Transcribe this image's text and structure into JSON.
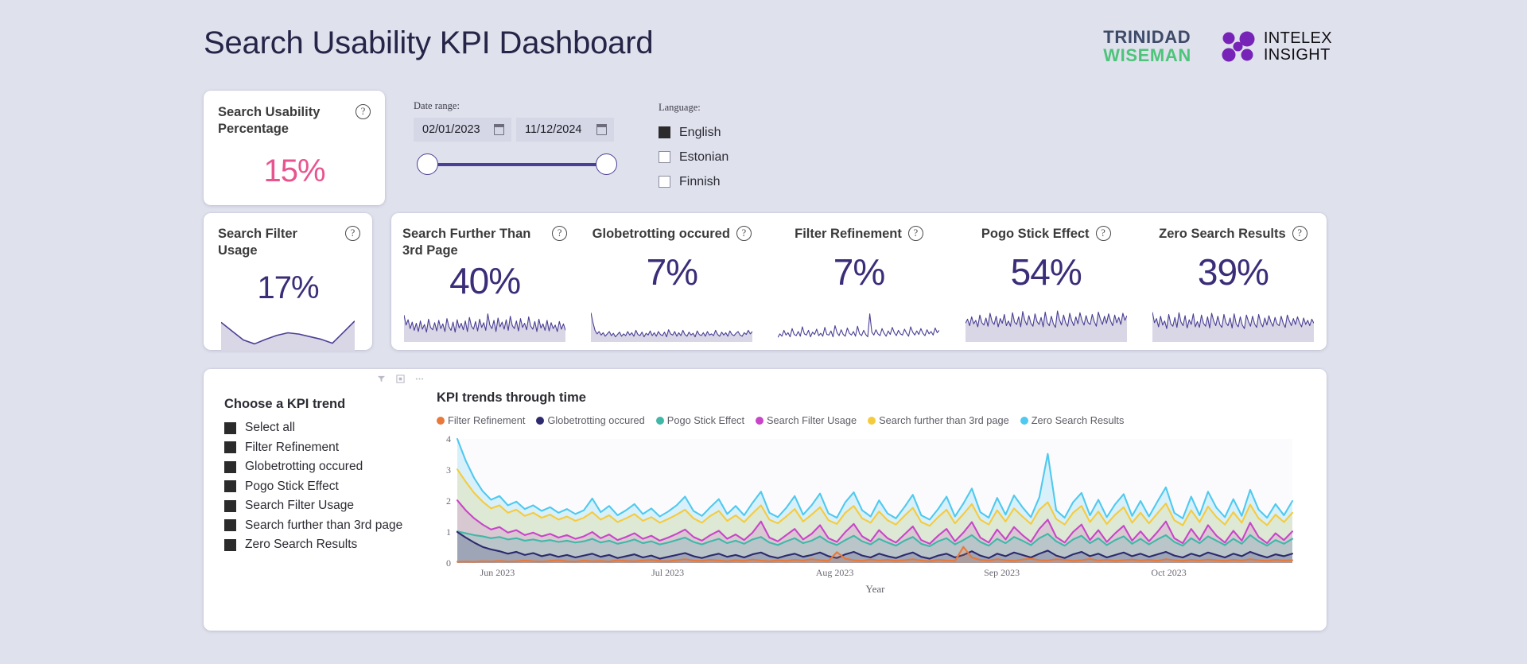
{
  "header": {
    "title": "Search Usability KPI Dashboard",
    "logo_trinidad_line1": "TRINIDAD",
    "logo_trinidad_line2": "WISEMAN",
    "logo_intelex_line1": "INTELEX",
    "logo_intelex_line2": "INSIGHT"
  },
  "usability_card": {
    "title": "Search Usability Percentage",
    "value": "15%",
    "help": "?",
    "color": "#e8548f"
  },
  "filters": {
    "date_label": "Date range:",
    "date_start": "02/01/2023",
    "date_end": "11/12/2024",
    "language_label": "Language:",
    "languages": [
      {
        "label": "English",
        "checked": true
      },
      {
        "label": "Estonian",
        "checked": false
      },
      {
        "label": "Finnish",
        "checked": false
      }
    ]
  },
  "filter_usage_card": {
    "title": "Search Filter Usage",
    "value": "17%",
    "help": "?"
  },
  "kpi_strip": [
    {
      "title": "Search Further Than 3rd Page",
      "value": "40%",
      "help": "?"
    },
    {
      "title": "Globetrotting occured",
      "value": "7%",
      "help": "?"
    },
    {
      "title": "Filter Refinement",
      "value": "7%",
      "help": "?"
    },
    {
      "title": "Pogo Stick Effect",
      "value": "54%",
      "help": "?"
    },
    {
      "title": "Zero Search Results",
      "value": "39%",
      "help": "?"
    }
  ],
  "kpi_chooser": {
    "title": "Choose a KPI trend",
    "items": [
      {
        "label": "Select all",
        "checked": true
      },
      {
        "label": "Filter Refinement",
        "checked": true
      },
      {
        "label": "Globetrotting occured",
        "checked": true
      },
      {
        "label": "Pogo Stick Effect",
        "checked": true
      },
      {
        "label": "Search Filter Usage",
        "checked": true
      },
      {
        "label": "Search further than 3rd page",
        "checked": true
      },
      {
        "label": "Zero Search Results",
        "checked": true
      }
    ]
  },
  "chart_data": {
    "type": "area",
    "title": "KPI trends through time",
    "xlabel": "Year",
    "ylabel": "",
    "ylim": [
      0,
      4
    ],
    "yticks": [
      0,
      1,
      2,
      3,
      4
    ],
    "grid": false,
    "legend_position": "top",
    "tick_labels": [
      "Jun 2023",
      "Jul 2023",
      "Aug 2023",
      "Sep 2023",
      "Oct 2023"
    ],
    "tick_positions": [
      0.048,
      0.252,
      0.452,
      0.652,
      0.852
    ],
    "series": [
      {
        "name": "Filter Refinement",
        "color": "#e8793a",
        "values": [
          0.04,
          0.05,
          0.04,
          0.06,
          0.05,
          0.07,
          0.05,
          0.06,
          0.08,
          0.06,
          0.05,
          0.07,
          0.09,
          0.06,
          0.05,
          0.08,
          0.06,
          0.07,
          0.05,
          0.09,
          0.07,
          0.06,
          0.08,
          0.1,
          0.07,
          0.06,
          0.09,
          0.12,
          0.08,
          0.07,
          0.1,
          0.08,
          0.06,
          0.09,
          0.07,
          0.11,
          0.08,
          0.06,
          0.09,
          0.07,
          0.1,
          0.08,
          0.12,
          0.09,
          0.07,
          0.35,
          0.14,
          0.09,
          0.07,
          0.11,
          0.08,
          0.1,
          0.07,
          0.09,
          0.12,
          0.08,
          0.06,
          0.1,
          0.08,
          0.07,
          0.52,
          0.18,
          0.1,
          0.08,
          0.12,
          0.09,
          0.07,
          0.11,
          0.14,
          0.09,
          0.08,
          0.12,
          0.1,
          0.07,
          0.09,
          0.13,
          0.08,
          0.1,
          0.07,
          0.09,
          0.11,
          0.08,
          0.1,
          0.07,
          0.12,
          0.09,
          0.07,
          0.1,
          0.08,
          0.11,
          0.09,
          0.07,
          0.1,
          0.08,
          0.12,
          0.09,
          0.07,
          0.1,
          0.08,
          0.09
        ]
      },
      {
        "name": "Globetrotting occured",
        "color": "#2d2a6e",
        "values": [
          1.0,
          0.82,
          0.66,
          0.52,
          0.44,
          0.38,
          0.3,
          0.36,
          0.26,
          0.32,
          0.22,
          0.28,
          0.2,
          0.26,
          0.18,
          0.24,
          0.3,
          0.2,
          0.26,
          0.16,
          0.22,
          0.28,
          0.18,
          0.24,
          0.14,
          0.2,
          0.26,
          0.32,
          0.22,
          0.16,
          0.24,
          0.3,
          0.2,
          0.26,
          0.18,
          0.28,
          0.34,
          0.22,
          0.16,
          0.24,
          0.3,
          0.2,
          0.26,
          0.34,
          0.22,
          0.16,
          0.28,
          0.36,
          0.24,
          0.18,
          0.3,
          0.22,
          0.16,
          0.26,
          0.34,
          0.2,
          0.14,
          0.24,
          0.3,
          0.18,
          0.26,
          0.38,
          0.24,
          0.16,
          0.3,
          0.22,
          0.34,
          0.26,
          0.18,
          0.3,
          0.4,
          0.24,
          0.16,
          0.28,
          0.36,
          0.22,
          0.3,
          0.18,
          0.26,
          0.34,
          0.22,
          0.3,
          0.2,
          0.28,
          0.36,
          0.24,
          0.18,
          0.3,
          0.22,
          0.34,
          0.26,
          0.18,
          0.3,
          0.22,
          0.36,
          0.26,
          0.18,
          0.28,
          0.22,
          0.3
        ]
      },
      {
        "name": "Pogo Stick Effect",
        "color": "#3fb8a8",
        "values": [
          1.02,
          0.96,
          0.9,
          0.86,
          0.8,
          0.84,
          0.76,
          0.8,
          0.72,
          0.76,
          0.7,
          0.74,
          0.68,
          0.72,
          0.66,
          0.7,
          0.78,
          0.66,
          0.72,
          0.62,
          0.68,
          0.76,
          0.64,
          0.7,
          0.6,
          0.66,
          0.74,
          0.82,
          0.68,
          0.6,
          0.7,
          0.78,
          0.64,
          0.72,
          0.62,
          0.76,
          0.84,
          0.66,
          0.58,
          0.7,
          0.8,
          0.64,
          0.72,
          0.86,
          0.68,
          0.58,
          0.74,
          0.88,
          0.7,
          0.6,
          0.78,
          0.66,
          0.56,
          0.72,
          0.84,
          0.62,
          0.54,
          0.7,
          0.8,
          0.6,
          0.74,
          0.9,
          0.68,
          0.56,
          0.78,
          0.64,
          0.84,
          0.72,
          0.58,
          0.8,
          0.94,
          0.7,
          0.56,
          0.76,
          0.88,
          0.64,
          0.8,
          0.58,
          0.74,
          0.86,
          0.62,
          0.78,
          0.6,
          0.76,
          0.9,
          0.68,
          0.56,
          0.8,
          0.64,
          0.86,
          0.72,
          0.58,
          0.78,
          0.62,
          0.9,
          0.7,
          0.56,
          0.74,
          0.62,
          0.78
        ]
      },
      {
        "name": "Search Filter Usage",
        "color": "#c845c8",
        "values": [
          2.02,
          1.7,
          1.44,
          1.24,
          1.08,
          1.16,
          0.98,
          1.06,
          0.9,
          0.98,
          0.86,
          0.94,
          0.82,
          0.9,
          0.78,
          0.86,
          1.0,
          0.8,
          0.92,
          0.74,
          0.84,
          0.96,
          0.78,
          0.88,
          0.72,
          0.82,
          0.94,
          1.08,
          0.84,
          0.72,
          0.9,
          1.04,
          0.78,
          0.92,
          0.74,
          0.98,
          1.34,
          0.82,
          0.7,
          0.9,
          1.1,
          0.76,
          0.94,
          1.22,
          0.8,
          0.68,
          1.0,
          1.26,
          0.86,
          0.7,
          1.06,
          0.8,
          0.66,
          0.92,
          1.18,
          0.74,
          0.62,
          0.88,
          1.1,
          0.7,
          0.98,
          1.32,
          0.82,
          0.66,
          1.08,
          0.76,
          1.16,
          0.9,
          0.68,
          1.1,
          1.4,
          0.84,
          0.66,
          1.0,
          1.24,
          0.74,
          1.06,
          0.68,
          0.96,
          1.2,
          0.72,
          1.02,
          0.7,
          1.0,
          1.34,
          0.8,
          0.64,
          1.1,
          0.74,
          1.22,
          0.88,
          0.66,
          1.04,
          0.72,
          1.3,
          0.84,
          0.64,
          0.96,
          0.74,
          1.02
        ]
      },
      {
        "name": "Search further than 3rd page",
        "color": "#f5cb3e",
        "values": [
          3.02,
          2.62,
          2.26,
          1.98,
          1.76,
          1.86,
          1.62,
          1.72,
          1.52,
          1.62,
          1.46,
          1.56,
          1.4,
          1.5,
          1.36,
          1.46,
          1.64,
          1.4,
          1.54,
          1.32,
          1.44,
          1.58,
          1.36,
          1.48,
          1.3,
          1.42,
          1.56,
          1.72,
          1.44,
          1.3,
          1.52,
          1.68,
          1.36,
          1.54,
          1.32,
          1.6,
          1.86,
          1.4,
          1.28,
          1.5,
          1.74,
          1.34,
          1.56,
          1.8,
          1.38,
          1.26,
          1.62,
          1.84,
          1.44,
          1.3,
          1.66,
          1.38,
          1.24,
          1.52,
          1.78,
          1.32,
          1.2,
          1.48,
          1.72,
          1.28,
          1.58,
          1.9,
          1.4,
          1.24,
          1.7,
          1.34,
          1.76,
          1.5,
          1.26,
          1.72,
          1.96,
          1.42,
          1.24,
          1.62,
          1.84,
          1.32,
          1.66,
          1.26,
          1.56,
          1.8,
          1.3,
          1.62,
          1.28,
          1.6,
          1.92,
          1.38,
          1.22,
          1.7,
          1.32,
          1.82,
          1.48,
          1.24,
          1.64,
          1.3,
          1.88,
          1.44,
          1.22,
          1.56,
          1.32,
          1.62
        ]
      },
      {
        "name": "Zero Search Results",
        "color": "#4fc9ef",
        "values": [
          4.0,
          3.3,
          2.74,
          2.32,
          2.04,
          2.16,
          1.86,
          1.98,
          1.74,
          1.86,
          1.68,
          1.8,
          1.62,
          1.74,
          1.58,
          1.7,
          2.08,
          1.64,
          1.84,
          1.54,
          1.7,
          1.9,
          1.58,
          1.76,
          1.5,
          1.66,
          1.86,
          2.14,
          1.68,
          1.52,
          1.8,
          2.06,
          1.58,
          1.84,
          1.54,
          1.94,
          2.3,
          1.62,
          1.48,
          1.78,
          2.16,
          1.56,
          1.86,
          2.24,
          1.6,
          1.46,
          1.96,
          2.28,
          1.7,
          1.5,
          2.02,
          1.6,
          1.44,
          1.8,
          2.2,
          1.54,
          1.4,
          1.74,
          2.14,
          1.5,
          1.92,
          2.4,
          1.64,
          1.46,
          2.1,
          1.56,
          2.18,
          1.8,
          1.48,
          2.12,
          3.52,
          1.7,
          1.46,
          1.96,
          2.26,
          1.54,
          2.04,
          1.48,
          1.9,
          2.22,
          1.52,
          2.0,
          1.5,
          1.98,
          2.44,
          1.62,
          1.44,
          2.14,
          1.54,
          2.3,
          1.78,
          1.48,
          2.06,
          1.52,
          2.36,
          1.72,
          1.46,
          1.9,
          1.54,
          2.0
        ]
      }
    ]
  },
  "sparklines": {
    "filter_usage": [
      0.82,
      0.55,
      0.28,
      0.16,
      0.3,
      0.42,
      0.5,
      0.46,
      0.38,
      0.3,
      0.18,
      0.52,
      0.86
    ],
    "further_3rd": [
      0.86,
      0.52,
      0.7,
      0.4,
      0.62,
      0.34,
      0.58,
      0.3,
      0.66,
      0.38,
      0.54,
      0.28,
      0.72,
      0.44,
      0.36,
      0.6,
      0.32,
      0.68,
      0.4,
      0.56,
      0.3,
      0.74,
      0.46,
      0.34,
      0.62,
      0.28,
      0.7,
      0.42,
      0.58,
      0.36,
      0.66,
      0.3,
      0.78,
      0.48,
      0.38,
      0.64,
      0.32,
      0.72,
      0.44,
      0.6,
      0.34,
      0.9,
      0.52,
      0.4,
      0.68,
      0.3,
      0.76,
      0.46,
      0.62,
      0.38,
      0.7,
      0.34,
      0.82,
      0.5,
      0.4,
      0.66,
      0.32,
      0.74,
      0.44,
      0.58,
      0.36,
      0.8,
      0.48,
      0.38,
      0.64,
      0.3,
      0.72,
      0.42,
      0.56,
      0.34,
      0.68,
      0.32,
      0.6,
      0.4,
      0.52,
      0.3,
      0.64,
      0.38,
      0.56,
      0.34
    ],
    "globetrotting": [
      0.94,
      0.6,
      0.34,
      0.22,
      0.3,
      0.18,
      0.26,
      0.14,
      0.22,
      0.3,
      0.16,
      0.24,
      0.12,
      0.2,
      0.28,
      0.14,
      0.22,
      0.16,
      0.3,
      0.18,
      0.26,
      0.14,
      0.34,
      0.2,
      0.16,
      0.28,
      0.12,
      0.24,
      0.18,
      0.32,
      0.16,
      0.26,
      0.14,
      0.3,
      0.2,
      0.16,
      0.28,
      0.12,
      0.36,
      0.22,
      0.18,
      0.3,
      0.14,
      0.26,
      0.16,
      0.34,
      0.2,
      0.14,
      0.28,
      0.18,
      0.24,
      0.12,
      0.32,
      0.2,
      0.16,
      0.26,
      0.14,
      0.3,
      0.18,
      0.22,
      0.16,
      0.34,
      0.2,
      0.14,
      0.28,
      0.18,
      0.26,
      0.14,
      0.32,
      0.2,
      0.16,
      0.24,
      0.3,
      0.18,
      0.14,
      0.26,
      0.2,
      0.34,
      0.22,
      0.3
    ],
    "filter_refinement": [
      0.1,
      0.22,
      0.14,
      0.34,
      0.18,
      0.26,
      0.12,
      0.4,
      0.2,
      0.16,
      0.3,
      0.14,
      0.46,
      0.22,
      0.18,
      0.34,
      0.12,
      0.28,
      0.2,
      0.38,
      0.16,
      0.24,
      0.14,
      0.44,
      0.2,
      0.18,
      0.32,
      0.12,
      0.5,
      0.26,
      0.16,
      0.36,
      0.2,
      0.14,
      0.42,
      0.24,
      0.18,
      0.3,
      0.14,
      0.48,
      0.22,
      0.16,
      0.34,
      0.2,
      0.12,
      0.9,
      0.28,
      0.18,
      0.36,
      0.22,
      0.16,
      0.4,
      0.24,
      0.14,
      0.32,
      0.2,
      0.44,
      0.26,
      0.16,
      0.34,
      0.22,
      0.18,
      0.38,
      0.24,
      0.14,
      0.46,
      0.28,
      0.18,
      0.32,
      0.2,
      0.4,
      0.24,
      0.16,
      0.36,
      0.22,
      0.3,
      0.18,
      0.42,
      0.26,
      0.34
    ],
    "pogo_stick": [
      0.58,
      0.72,
      0.5,
      0.8,
      0.56,
      0.68,
      0.46,
      0.86,
      0.6,
      0.52,
      0.76,
      0.48,
      0.92,
      0.64,
      0.54,
      0.82,
      0.46,
      0.74,
      0.58,
      0.88,
      0.5,
      0.66,
      0.48,
      0.94,
      0.62,
      0.54,
      0.8,
      0.46,
      0.98,
      0.68,
      0.52,
      0.84,
      0.58,
      0.48,
      0.9,
      0.64,
      0.54,
      0.78,
      0.46,
      0.96,
      0.6,
      0.5,
      0.82,
      0.56,
      0.44,
      1.0,
      0.7,
      0.52,
      0.86,
      0.6,
      0.48,
      0.92,
      0.66,
      0.5,
      0.8,
      0.56,
      0.94,
      0.68,
      0.52,
      0.84,
      0.6,
      0.54,
      0.88,
      0.64,
      0.48,
      0.96,
      0.72,
      0.54,
      0.82,
      0.58,
      0.9,
      0.66,
      0.5,
      0.86,
      0.6,
      0.78,
      0.54,
      0.92,
      0.68,
      0.84
    ],
    "zero_results": [
      0.96,
      0.6,
      0.74,
      0.46,
      0.82,
      0.52,
      0.66,
      0.4,
      0.88,
      0.56,
      0.48,
      0.78,
      0.44,
      0.94,
      0.62,
      0.5,
      0.84,
      0.42,
      0.7,
      0.54,
      0.9,
      0.46,
      0.64,
      0.44,
      0.86,
      0.58,
      0.48,
      0.8,
      0.42,
      0.92,
      0.66,
      0.5,
      0.82,
      0.54,
      0.44,
      0.88,
      0.6,
      0.5,
      0.76,
      0.42,
      0.9,
      0.56,
      0.46,
      0.8,
      0.52,
      0.4,
      0.86,
      0.64,
      0.48,
      0.82,
      0.56,
      0.44,
      0.88,
      0.6,
      0.46,
      0.76,
      0.52,
      0.84,
      0.62,
      0.48,
      0.78,
      0.56,
      0.5,
      0.82,
      0.58,
      0.44,
      0.86,
      0.66,
      0.5,
      0.74,
      0.54,
      0.8,
      0.6,
      0.46,
      0.76,
      0.54,
      0.68,
      0.5,
      0.72,
      0.58
    ]
  },
  "panel_toolbar": [
    "filter-icon",
    "focus-icon",
    "more-options-icon"
  ]
}
